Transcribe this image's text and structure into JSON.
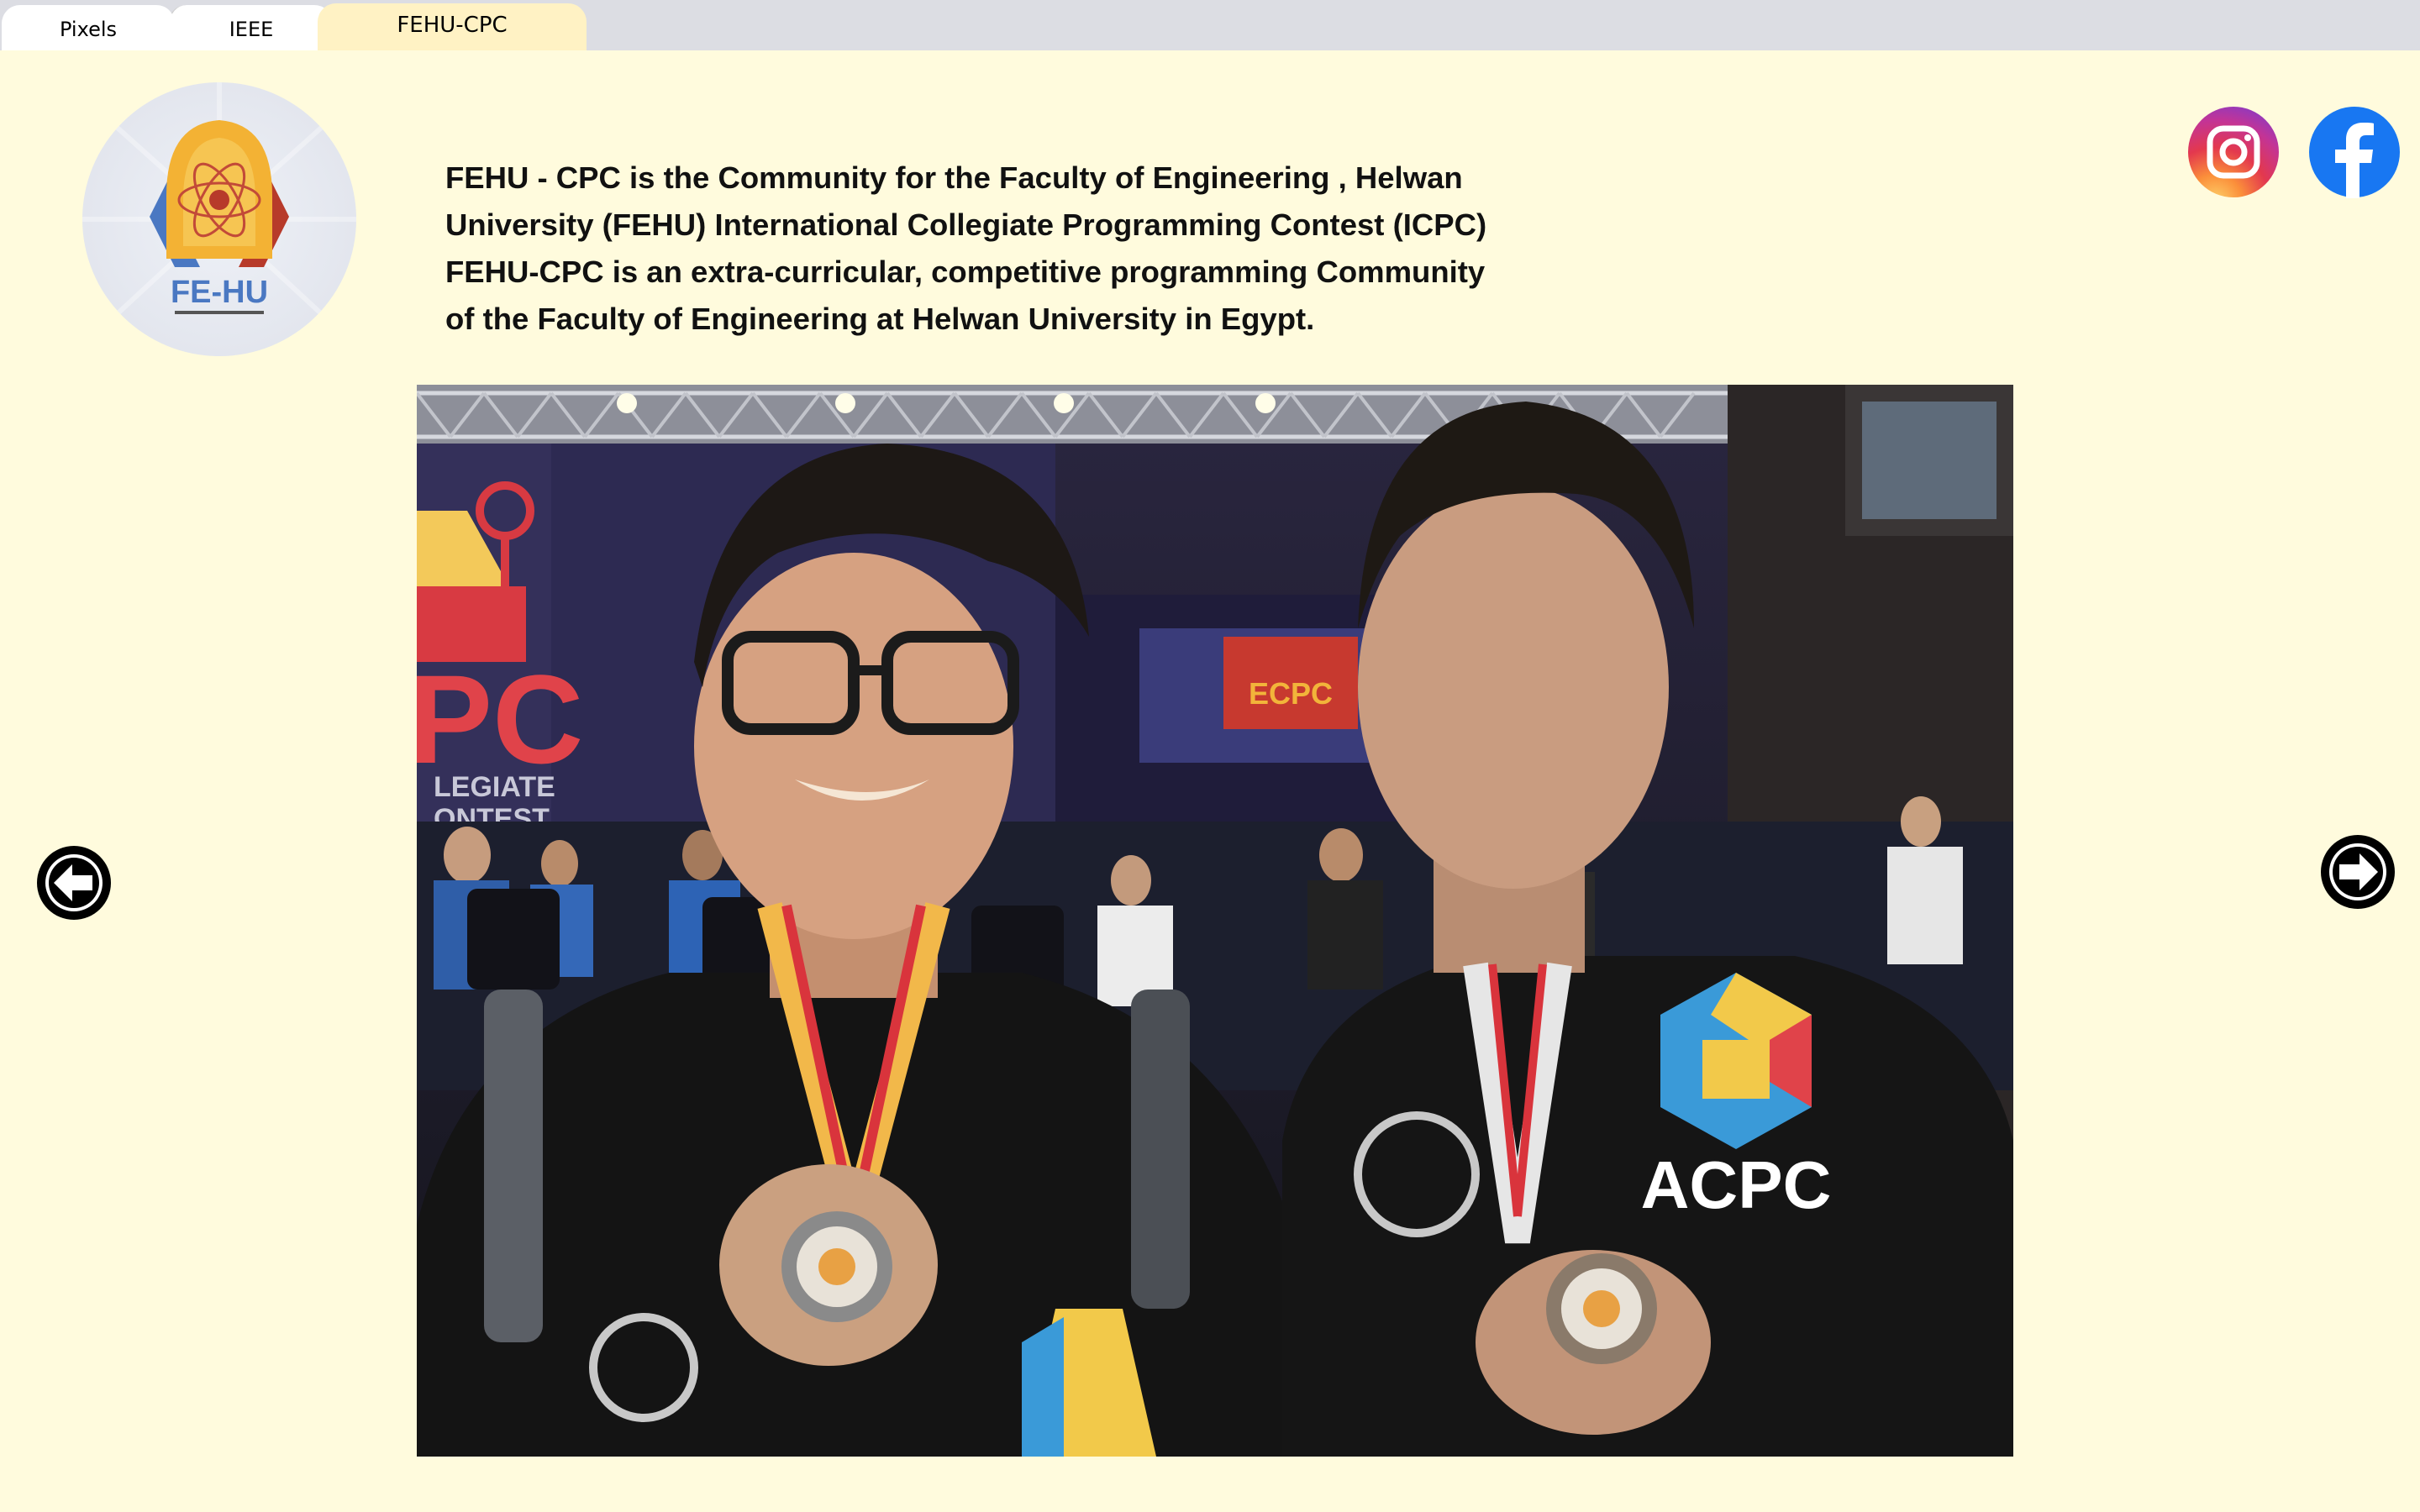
{
  "tabs": [
    {
      "label": "Pixels"
    },
    {
      "label": "IEEE"
    },
    {
      "label": "FEHU-CPC"
    }
  ],
  "logo": {
    "text": "FE-HU"
  },
  "description": {
    "lines": [
      "FEHU - CPC is the Community for the Faculty of Engineering , Helwan",
      "University (FEHU) International Collegiate Programming Contest (ICPC)",
      "FEHU-CPC is an extra-curricular, competitive programming Community",
      "of the Faculty of Engineering at Helwan University in Egypt."
    ]
  },
  "social": {
    "instagram_icon": "instagram-icon",
    "facebook_icon": "facebook-icon"
  },
  "carousel": {
    "prev_icon": "arrow-left-icon",
    "next_icon": "arrow-right-icon",
    "photo_texts": {
      "banner_letters": "PC",
      "banner_sub1": "LEGIATE",
      "banner_sub2": "ONTEST",
      "screen_text": "ECPC",
      "shirt_text": "ACPC"
    }
  },
  "colors": {
    "background": "#fffbdd",
    "tabbar": "#dcdde3",
    "active_tab": "#fff2c4",
    "facebook_blue": "#1877f2"
  }
}
